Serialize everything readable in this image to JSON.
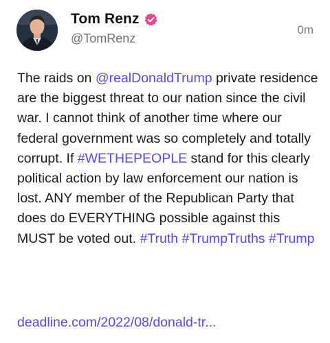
{
  "author": {
    "name": "Tom Renz",
    "handle": "@TomRenz",
    "verified_icon": "verified-badge-icon",
    "avatar_icon": "avatar-photo"
  },
  "post": {
    "time": "0m",
    "segments": {
      "s1": "The raids on ",
      "mention": "@realDonaldTrump",
      "s2": " private residence are the biggest threat to our nation since the civil war. I cannot think of another time where our federal government was so completely and totally corrupt. If ",
      "hashtag1": "#WETHEPEOPLE",
      "s3": " stand for this clearly political action by law enforcement our nation is lost. ANY member of the Republican Party that does do EVERYTHING possible against this MUST be voted out. ",
      "hashtag2": "#Truth",
      "hashtag3": "#TrumpTruths",
      "hashtag4": "#Trump"
    },
    "link": "deadline.com/2022/08/donald-tr..."
  },
  "colors": {
    "accent": "#5448ee",
    "verified": "#e8478b",
    "muted": "#6f6f76"
  }
}
